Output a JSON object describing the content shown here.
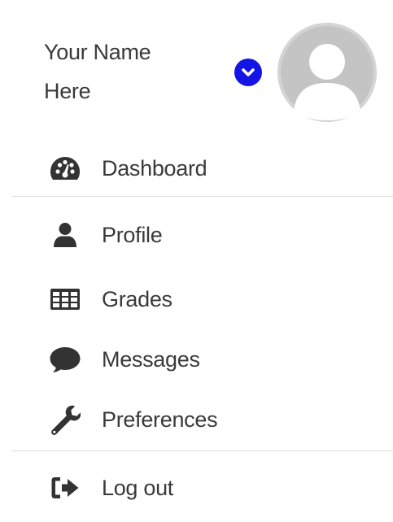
{
  "user": {
    "name_line1": "Your Name",
    "name_line2": "Here",
    "toggle_icon": "chevron-down-icon",
    "avatar_icon": "user-avatar-icon"
  },
  "menu": {
    "items": [
      {
        "label": "Dashboard",
        "icon": "dashboard-icon"
      },
      {
        "label": "Profile",
        "icon": "user-icon"
      },
      {
        "label": "Grades",
        "icon": "table-icon"
      },
      {
        "label": "Messages",
        "icon": "comment-icon"
      },
      {
        "label": "Preferences",
        "icon": "wrench-icon"
      },
      {
        "label": "Log out",
        "icon": "sign-out-icon"
      }
    ]
  },
  "colors": {
    "accent": "#1414e6",
    "text": "#3a3a3a",
    "icon": "#333333",
    "divider": "#dedede",
    "avatar_bg": "#d9d9d9"
  }
}
